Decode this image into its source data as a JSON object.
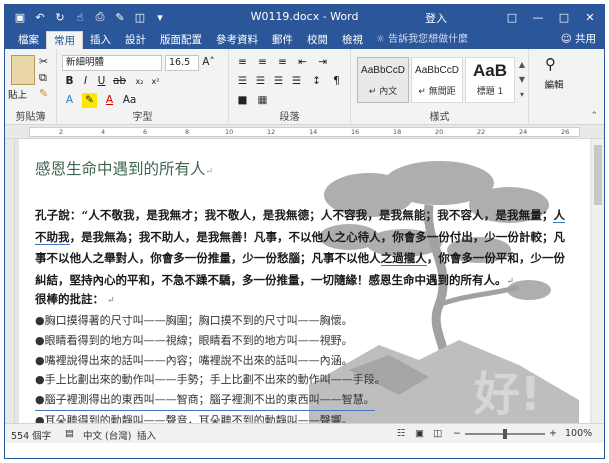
{
  "titlebar": {
    "title": "W0119.docx - Word",
    "signin": "登入",
    "qat": [
      "save-icon",
      "undo-icon",
      "redo-icon",
      "touch-mode-icon",
      "print-preview-icon",
      "format-painter-icon",
      "open-icon",
      "customize-icon"
    ]
  },
  "tabs": [
    {
      "label": "檔案"
    },
    {
      "label": "常用"
    },
    {
      "label": "插入"
    },
    {
      "label": "設計"
    },
    {
      "label": "版面配置"
    },
    {
      "label": "參考資料"
    },
    {
      "label": "郵件"
    },
    {
      "label": "校閱"
    },
    {
      "label": "檢視"
    }
  ],
  "tellme": "告訴我您想做什麼",
  "share": "共用",
  "ribbon": {
    "groups": {
      "clipboard": "剪貼簿",
      "font": "字型",
      "paragraph": "段落",
      "styles": "樣式",
      "editing": "編輯"
    },
    "font_name": "新細明體",
    "font_size": "16.5",
    "paste_label": "貼上",
    "styles": [
      {
        "preview": "AaBbCcD",
        "name": "↵ 內文"
      },
      {
        "preview": "AaBbCcD",
        "name": "↵ 無間距"
      },
      {
        "preview": "AaB",
        "name": "標題 1"
      }
    ]
  },
  "document": {
    "heading": "感恩生命中遇到的所有人",
    "para_part1": "孔子說：“人不敬我，是我無才；我不敬人，是我無德；人不容我，是我無能；我不容人，是我無量；",
    "para_link1": "人不助我",
    "para_part2": "，是我無為；我不助人，是我無善！凡事，不以他人之心待人，你會多一份付出，少一份計較；凡事不以他人之舉對人，你會多一份推量，少一份愁腦；凡事不以他人",
    "para_link2": "之過攏人",
    "para_part3": "，你會多一份平和，少一份糾結，堅持內心的平和，不急不躁不驕，多一份推量，一切隨緣！感恩生命中遇到的所有人。",
    "subheading": "很棒的批註：",
    "bullets": [
      "●胸口摸得著的尺寸叫——胸圍；胸口摸不到的尺寸叫——胸懷。",
      "●眼睛看得到的地方叫——視線；眼睛看不到的地方叫——視野。",
      "●嘴裡說得出來的話叫——內容；嘴裡說不出來的話叫——內涵。",
      "●手上比劃出來的動作叫——手勢；手上比劃不出來的動作叫——手段。",
      "●腦子裡測得出的東西叫——智商；腦子裡測不出的東西叫——智慧。",
      "●耳朵聽得到的動靜叫——聲音，耳朵聽不到的動靜叫——聲響。"
    ]
  },
  "status": {
    "words": "554 個字",
    "language": "中文 (台灣)",
    "mode": "插入",
    "zoom": "100%"
  }
}
